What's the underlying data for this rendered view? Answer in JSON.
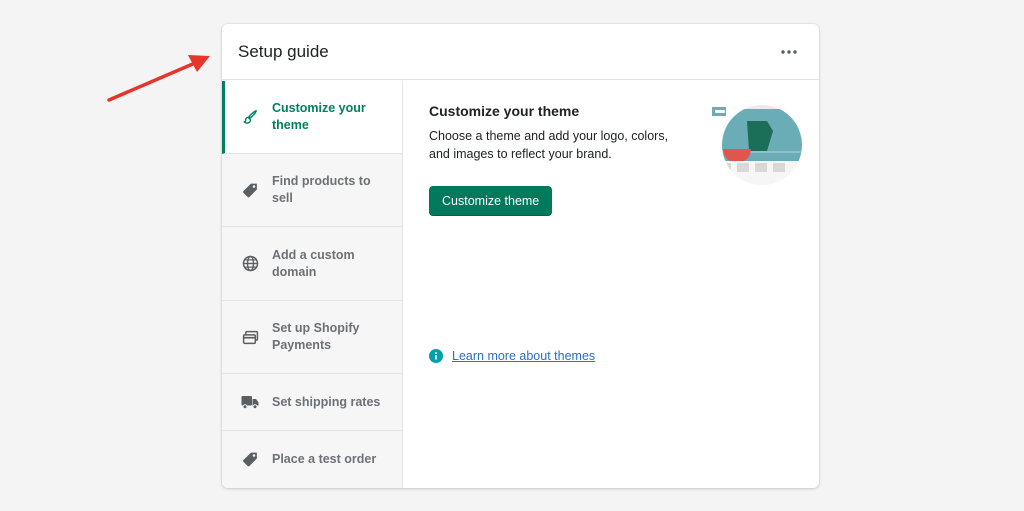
{
  "card": {
    "title": "Setup guide",
    "more_icon": "horizontal-dots-icon"
  },
  "steps": [
    {
      "label": "Customize your theme",
      "icon": "paintbrush-icon",
      "active": true
    },
    {
      "label": "Find products to sell",
      "icon": "tag-icon",
      "active": false
    },
    {
      "label": "Add a custom domain",
      "icon": "globe-icon",
      "active": false
    },
    {
      "label": "Set up Shopify Payments",
      "icon": "payment-card-icon",
      "active": false
    },
    {
      "label": "Set shipping rates",
      "icon": "truck-icon",
      "active": false
    },
    {
      "label": "Place a test order",
      "icon": "tag-icon",
      "active": false
    }
  ],
  "content": {
    "title": "Customize your theme",
    "description": "Choose a theme and add your logo, colors, and images to reflect your brand.",
    "primary_button": "Customize theme",
    "learn_more": "Learn more about themes",
    "learn_icon": "info-icon",
    "illustration_icon": "theme-illustration-icon"
  },
  "colors": {
    "accent": "#008060",
    "button": "#007a5a",
    "link": "#2c6ecb",
    "annotation_arrow": "#e8352a"
  }
}
